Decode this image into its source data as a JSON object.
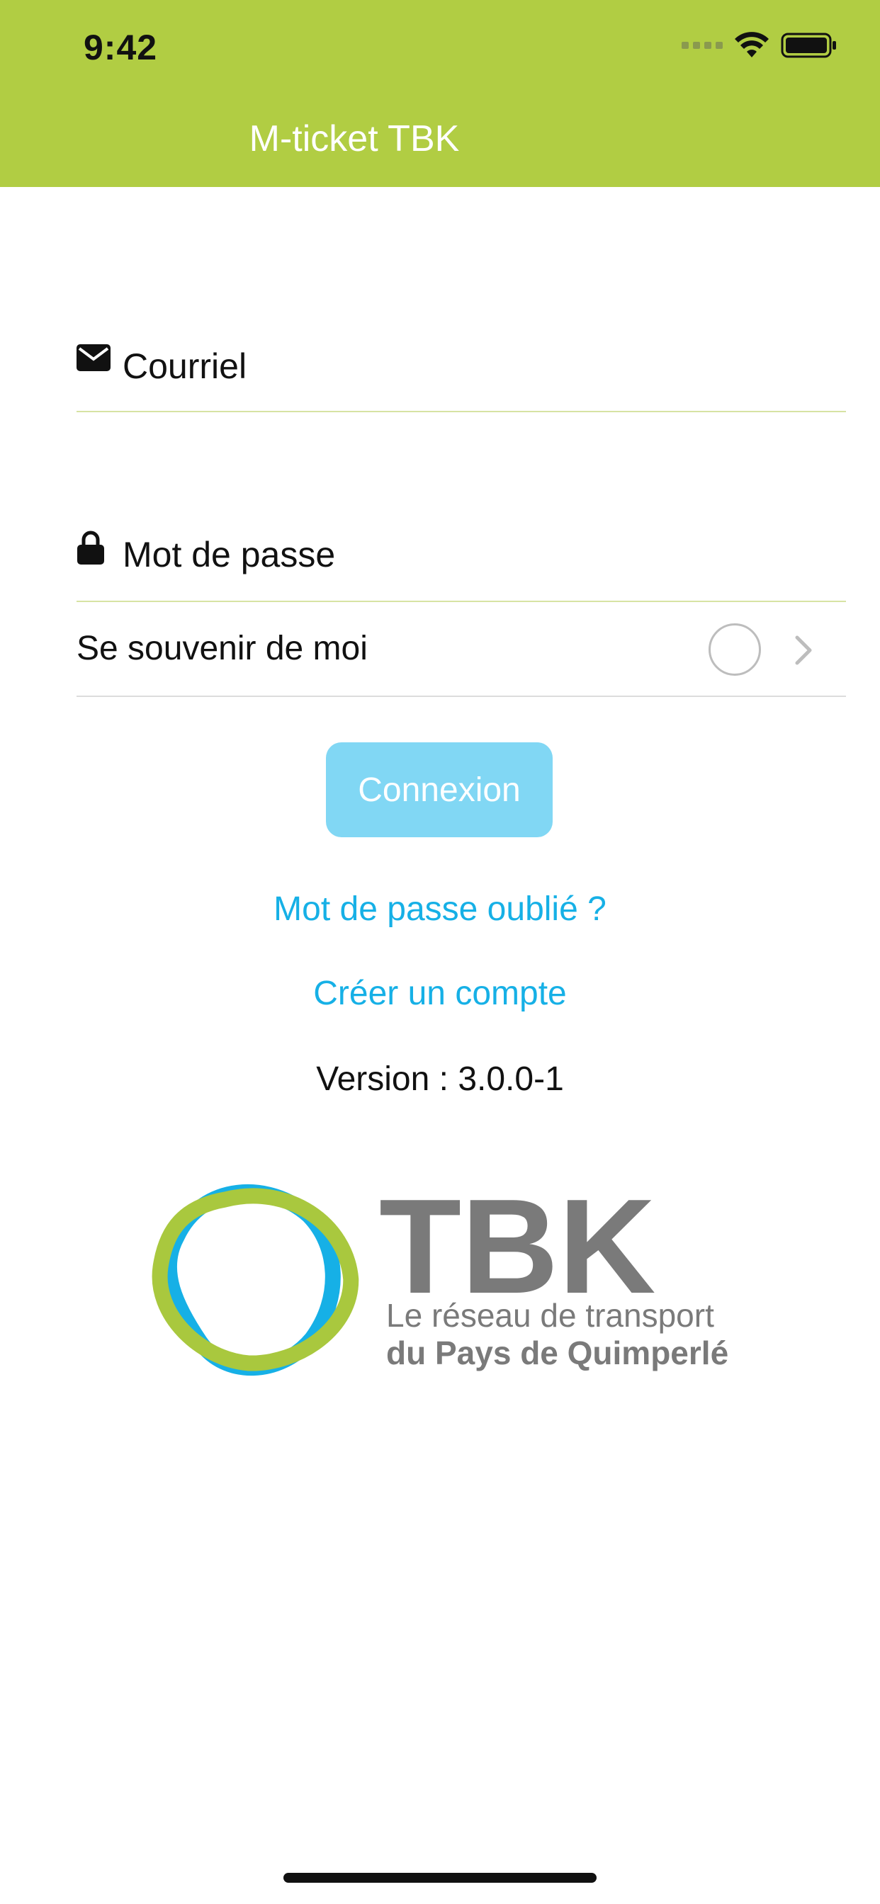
{
  "status_bar": {
    "time": "9:42"
  },
  "nav": {
    "title": "M-ticket TBK"
  },
  "form": {
    "email_placeholder": "Courriel",
    "password_placeholder": "Mot de passe",
    "remember_label": "Se souvenir de moi",
    "remember_checked": false,
    "login_button": "Connexion"
  },
  "links": {
    "forgot_password": "Mot de passe oublié ?",
    "create_account": "Créer un compte"
  },
  "version": "Version : 3.0.0-1",
  "logo": {
    "name": "TBK",
    "tagline_1": "Le réseau de transport",
    "tagline_2": "du Pays de Quimperlé"
  },
  "colors": {
    "header_bg": "#b1cd43",
    "link": "#16b0e6",
    "button_bg": "#81d7f4",
    "logo_blue": "#16b0e6",
    "logo_green": "#a9c83e",
    "logo_gray": "#7a7a7a"
  },
  "icons": [
    "mail-icon",
    "lock-icon",
    "wifi-icon",
    "battery-icon",
    "cellular-signal-icon",
    "chevron-right-icon"
  ]
}
